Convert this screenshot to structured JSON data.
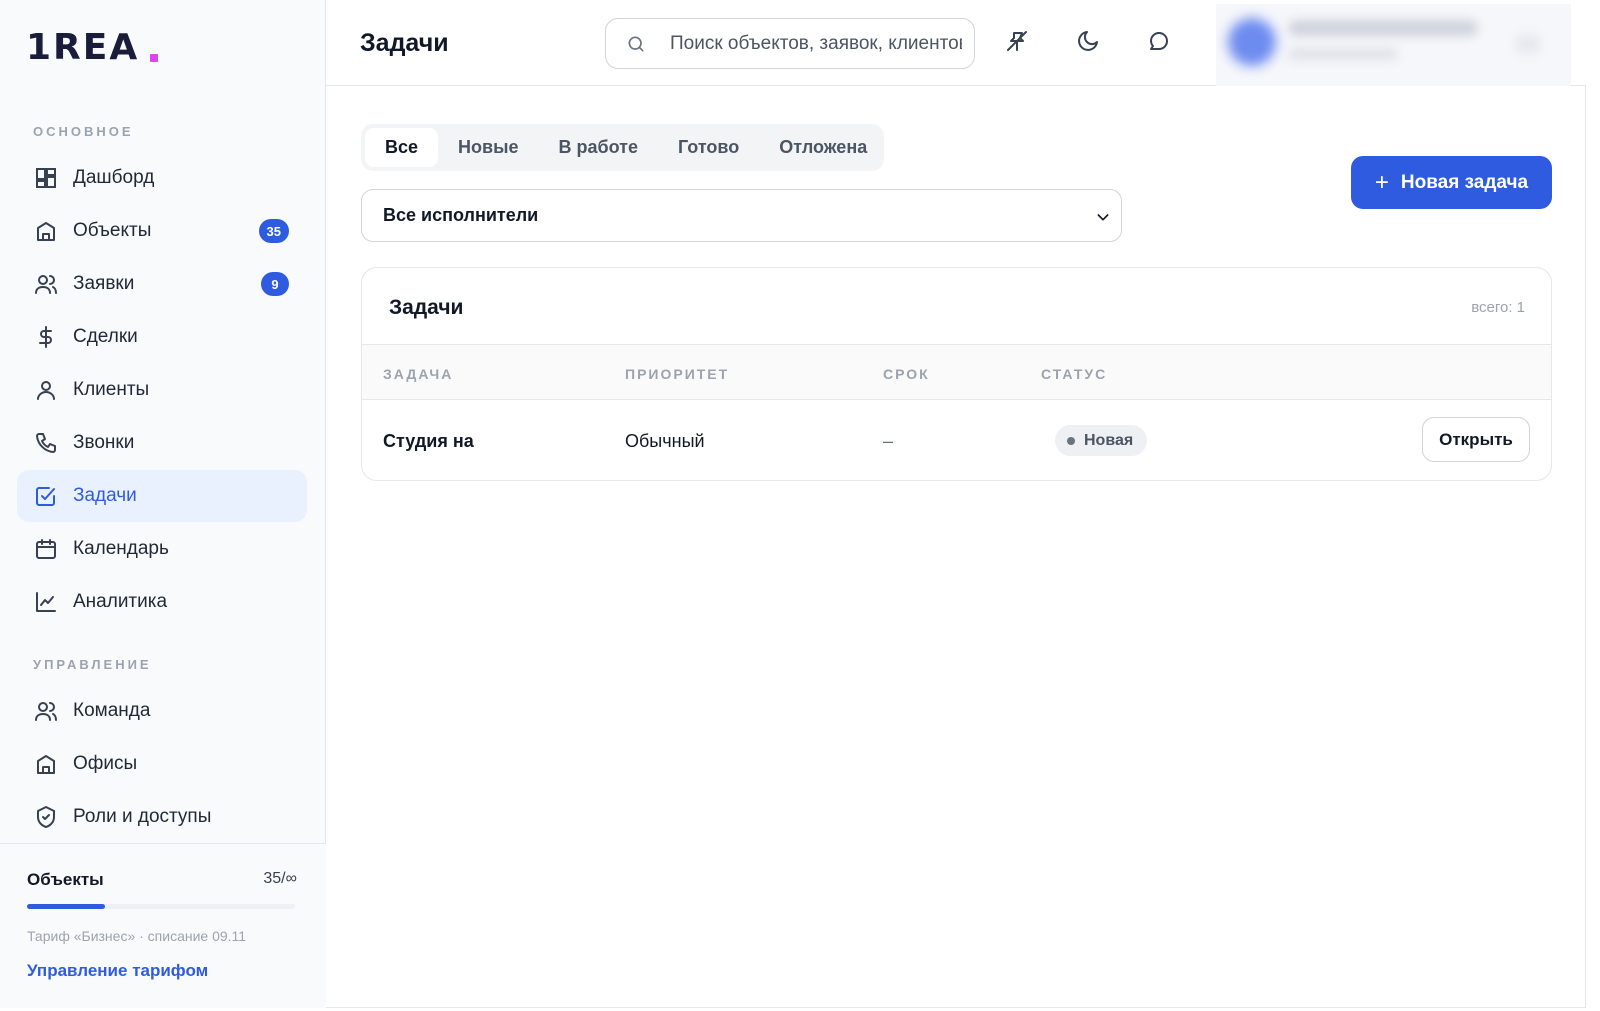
{
  "brand": {
    "logo_text": "1REA"
  },
  "sidebar": {
    "sections": [
      {
        "title": "ОСНОВНОЕ"
      },
      {
        "title": "УПРАВЛЕНИЕ"
      }
    ],
    "items": [
      {
        "label": "Дашборд",
        "icon": "dashboard-icon"
      },
      {
        "label": "Объекты",
        "icon": "building-icon",
        "badge": "35"
      },
      {
        "label": "Заявки",
        "icon": "users-icon",
        "badge": "9"
      },
      {
        "label": "Сделки",
        "icon": "dollar-icon"
      },
      {
        "label": "Клиенты",
        "icon": "user-icon"
      },
      {
        "label": "Звонки",
        "icon": "phone-icon"
      },
      {
        "label": "Задачи",
        "icon": "checkbox-icon",
        "active": true
      },
      {
        "label": "Календарь",
        "icon": "calendar-icon"
      },
      {
        "label": "Аналитика",
        "icon": "chart-icon"
      },
      {
        "label": "Команда",
        "icon": "team-icon"
      },
      {
        "label": "Офисы",
        "icon": "office-icon"
      },
      {
        "label": "Роли и доступы",
        "icon": "shield-icon"
      }
    ],
    "footer": {
      "quota_label": "Объекты",
      "quota_value": "35/∞",
      "quota_fill_fraction": 0.29,
      "plan_text": "Тариф «Бизнес» · списание 09.11",
      "manage_link": "Управление тарифом"
    }
  },
  "header": {
    "title": "Задачи",
    "search_placeholder": "Поиск объектов, заявок, клиентов",
    "icons": [
      "pin-off-icon",
      "moon-icon",
      "chat-icon"
    ]
  },
  "tabs": [
    {
      "label": "Все",
      "active": true
    },
    {
      "label": "Новые"
    },
    {
      "label": "В работе"
    },
    {
      "label": "Готово"
    },
    {
      "label": "Отложена"
    }
  ],
  "actions": {
    "new_task_label": "Новая задача",
    "new_task_icon": "+"
  },
  "filter": {
    "selected": "Все исполнители"
  },
  "table": {
    "title": "Задачи",
    "count_text": "всего: 1",
    "columns": [
      "ЗАДАЧА",
      "ПРИОРИТЕТ",
      "СРОК",
      "СТАТУС"
    ],
    "rows": [
      {
        "task": "Студия на",
        "priority": "Обычный",
        "due": "–",
        "status": "Новая",
        "action": "Открыть"
      }
    ]
  },
  "colors": {
    "accent": "#2f5be0",
    "active_bg": "#eaf1fe"
  }
}
